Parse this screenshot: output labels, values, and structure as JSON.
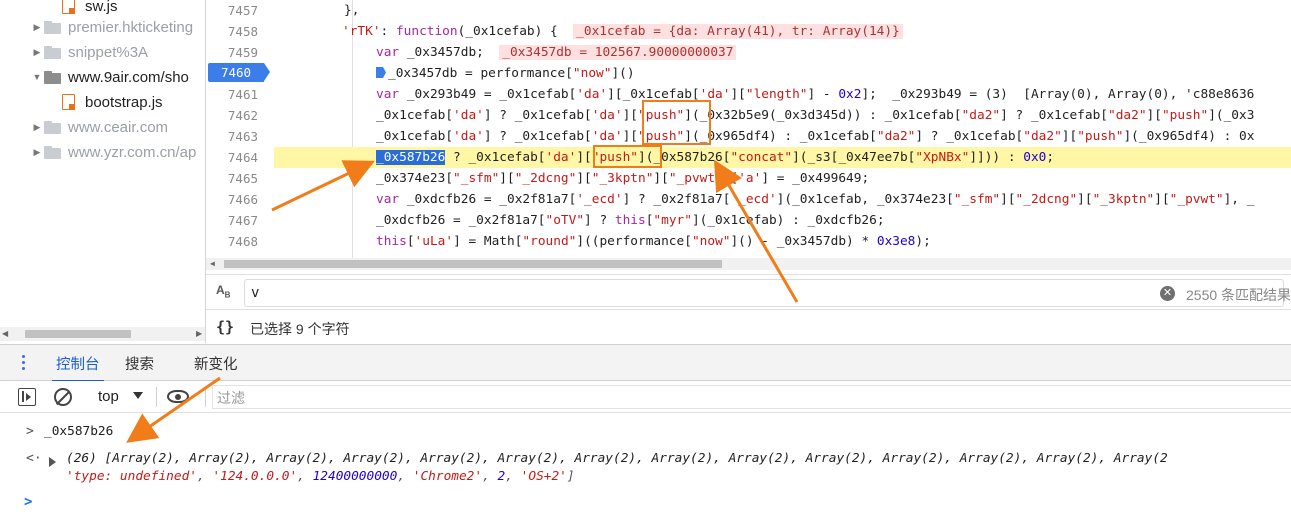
{
  "file_tree": {
    "items": [
      {
        "label": "sw.js",
        "type": "file",
        "depth": 1
      },
      {
        "label": "premier.hkticketing",
        "type": "folder",
        "state": "collapsed"
      },
      {
        "label": "snippet%3A",
        "type": "folder",
        "state": "collapsed"
      },
      {
        "label": "www.9air.com/sho",
        "type": "folder",
        "state": "expanded"
      },
      {
        "label": "bootstrap.js",
        "type": "file",
        "depth": 1
      },
      {
        "label": "www.ceair.com",
        "type": "folder",
        "state": "collapsed"
      },
      {
        "label": "www.yzr.com.cn/ap",
        "type": "folder",
        "state": "collapsed"
      }
    ]
  },
  "editor": {
    "active_line": "7460",
    "highlighted_line": "7464",
    "lines": [
      {
        "num": "7457",
        "text": "},"
      },
      {
        "num": "7458",
        "text": "'rTK': function(_0x1cefab) {  _0x1cefab = {da: Array(41), tr: Array(14)}"
      },
      {
        "num": "7459",
        "text": "var _0x3457db;  _0x3457db = 102567.90000000037"
      },
      {
        "num": "7460",
        "text": "_0x3457db = performance[\"now\"]()"
      },
      {
        "num": "7461",
        "text": "var _0x293b49 = _0x1cefab['da'][_0x1cefab['da'][\"length\"] - 0x2];  _0x293b49 = (3)  [Array(0), Array(0), 'c88e8636"
      },
      {
        "num": "7462",
        "text": "_0x1cefab['da'] ? _0x1cefab['da'][\"push\"](_0x32b5e9(_0x3d345d)) : _0x1cefab[\"da2\"] ? _0x1cefab[\"da2\"][\"push\"](_0x3"
      },
      {
        "num": "7463",
        "text": "_0x1cefab['da'] ? _0x1cefab['da'][\"push\"](_0x965df4) : _0x1cefab[\"da2\"] ? _0x1cefab[\"da2\"][\"push\"](_0x965df4) : 0x"
      },
      {
        "num": "7464",
        "text": "_0x587b26 ? _0x1cefab['da'][\"push\"](_0x587b26[\"concat\"](_s3[_0x47ee7b[\"XpNBx\"]])) : 0x0;"
      },
      {
        "num": "7465",
        "text": "_0x374e23[\"_sfm\"][\"_2dcng\"][\"_3kptn\"][\"_pvwt\"]['a'] = _0x499649;"
      },
      {
        "num": "7466",
        "text": "var _0xdcfb26 = _0x2f81a7['_ecd'] ? _0x2f81a7['_ecd'](_0x1cefab, _0x374e23[\"_sfm\"][\"_2dcng\"][\"_3kptn\"][\"_pvwt\"], _"
      },
      {
        "num": "7467",
        "text": "_0xdcfb26 = _0x2f81a7[\"oTV\"] ? this[\"myr\"](_0x1cefab) : _0xdcfb26;"
      },
      {
        "num": "7468",
        "text": "this['uLa'] = Math[\"round\"]((performance[\"now\"]() - _0x3457db) * 0x3e8);"
      }
    ]
  },
  "search": {
    "case_icon": "A͟B",
    "value": "v",
    "match_count": "2550 条匹配结果"
  },
  "status": {
    "braces": "{}",
    "text": "已选择 9 个字符"
  },
  "drawer": {
    "tabs": [
      "控制台",
      "搜索",
      "新变化"
    ],
    "active_tab": "控制台"
  },
  "console_toolbar": {
    "context": "top",
    "filter_placeholder": "过滤"
  },
  "console": {
    "input_prompt": ">",
    "input": "_0x587b26",
    "result_prompt": "<·",
    "result_line1": "(26)  [Array(2), Array(2), Array(2), Array(2), Array(2), Array(2), Array(2), Array(2), Array(2), Array(2), Array(2), Array(2), Array(2), Array(2",
    "result_line2_parts": [
      "'type: undefined'",
      "'124.0.0.0'",
      "12400000000",
      "'Chrome2'",
      "2",
      "'OS+2'"
    ],
    "cursor_prompt": ">"
  },
  "colors": {
    "accent": "#1a5fd0",
    "breakpoint": "#3b7de9",
    "annotation": "#f07d1a",
    "line_highlight": "#fff7a5"
  }
}
